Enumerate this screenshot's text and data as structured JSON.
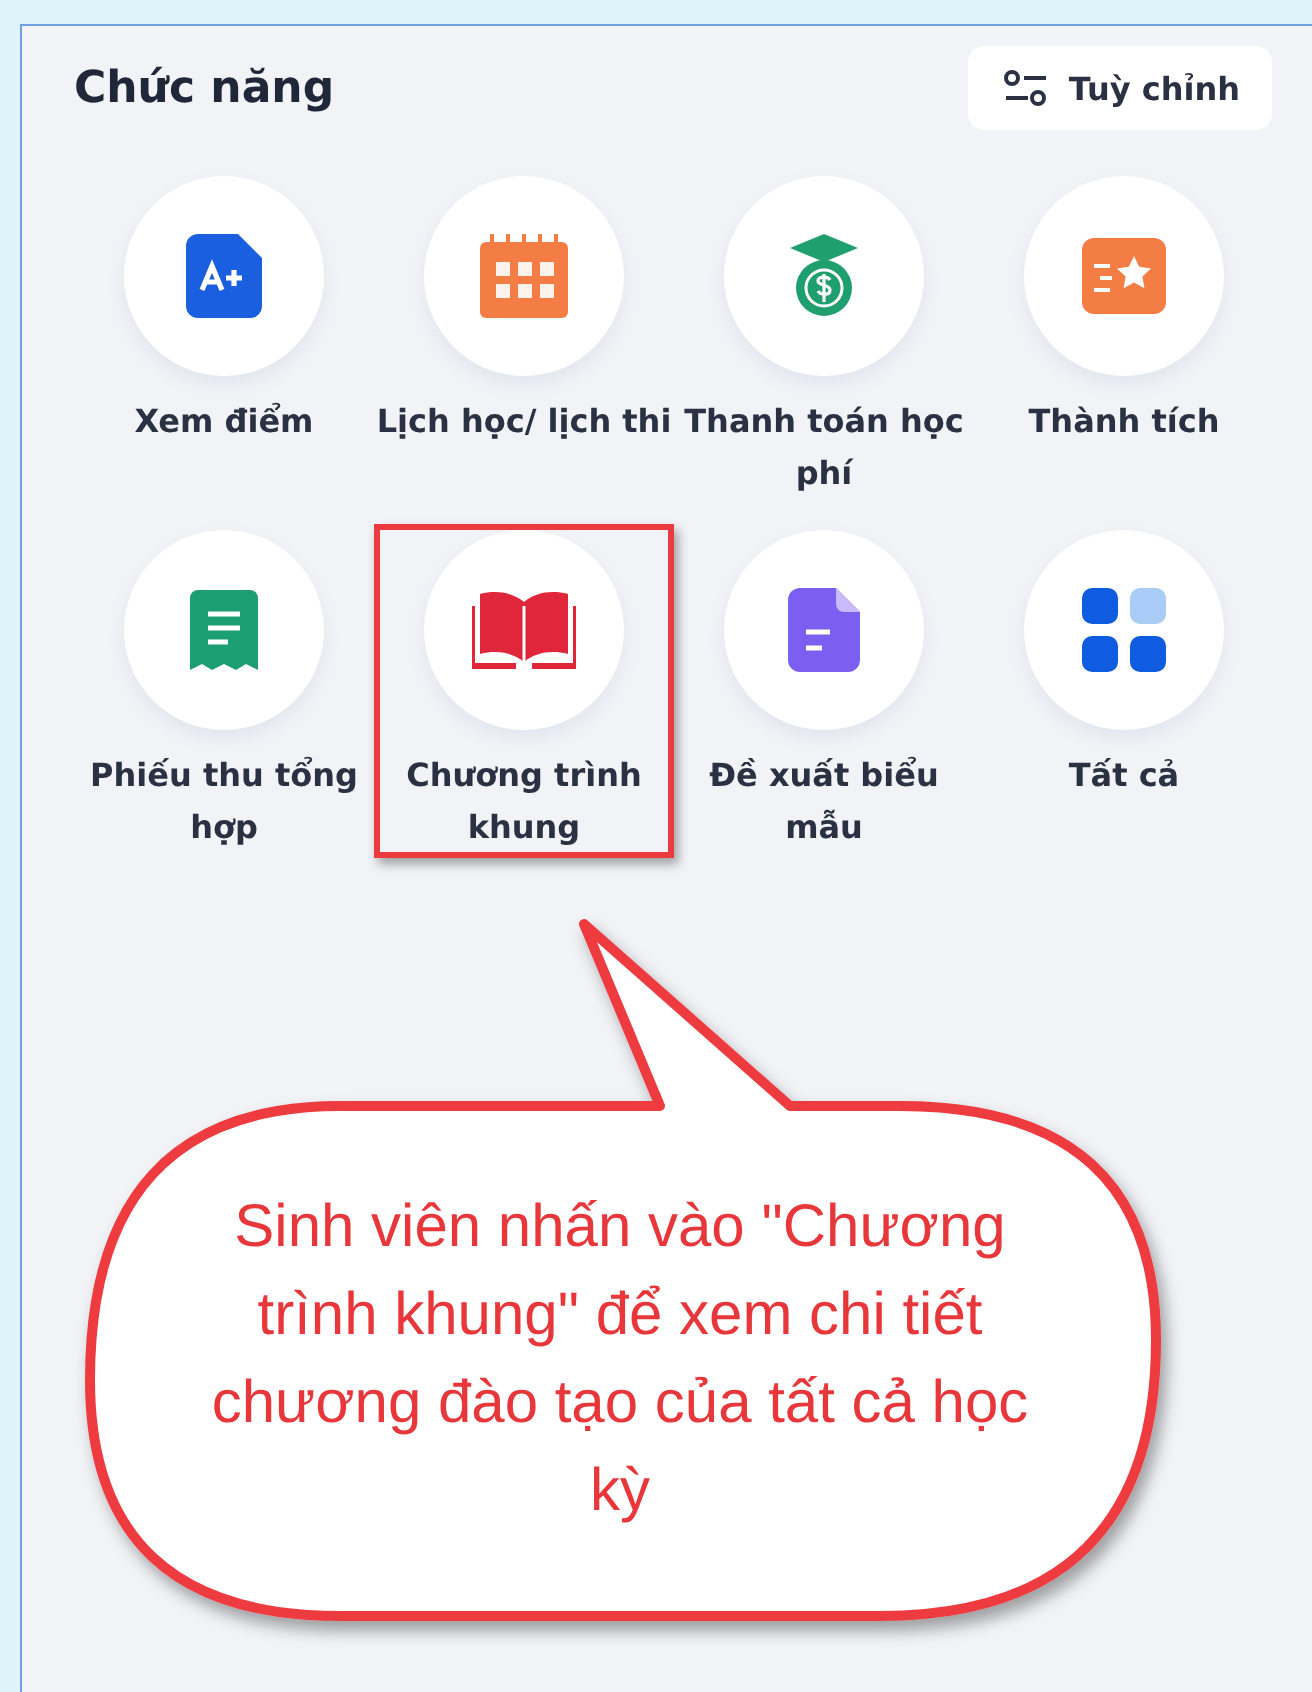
{
  "panel": {
    "title": "Chức năng",
    "customize_button": "Tuỳ chỉnh"
  },
  "functions": [
    {
      "label": "Xem điểm",
      "kind": "grades",
      "highlighted": false
    },
    {
      "label": "Lịch học/ lịch thi",
      "kind": "schedule",
      "highlighted": false
    },
    {
      "label": "Thanh toán học phí",
      "kind": "tuition",
      "highlighted": false
    },
    {
      "label": "Thành tích",
      "kind": "achievement",
      "highlighted": false
    },
    {
      "label": "Phiếu thu tổng hợp",
      "kind": "receipt",
      "highlighted": false
    },
    {
      "label": "Chương trình khung",
      "kind": "curriculum",
      "highlighted": true
    },
    {
      "label": "Đề xuất biểu mẫu",
      "kind": "form",
      "highlighted": false
    },
    {
      "label": "Tất cả",
      "kind": "all",
      "highlighted": false
    }
  ],
  "callout": {
    "text": "Sinh viên nhấn vào \"Chương trình khung\" để xem chi tiết chương đào tạo của tất cả học kỳ"
  }
}
